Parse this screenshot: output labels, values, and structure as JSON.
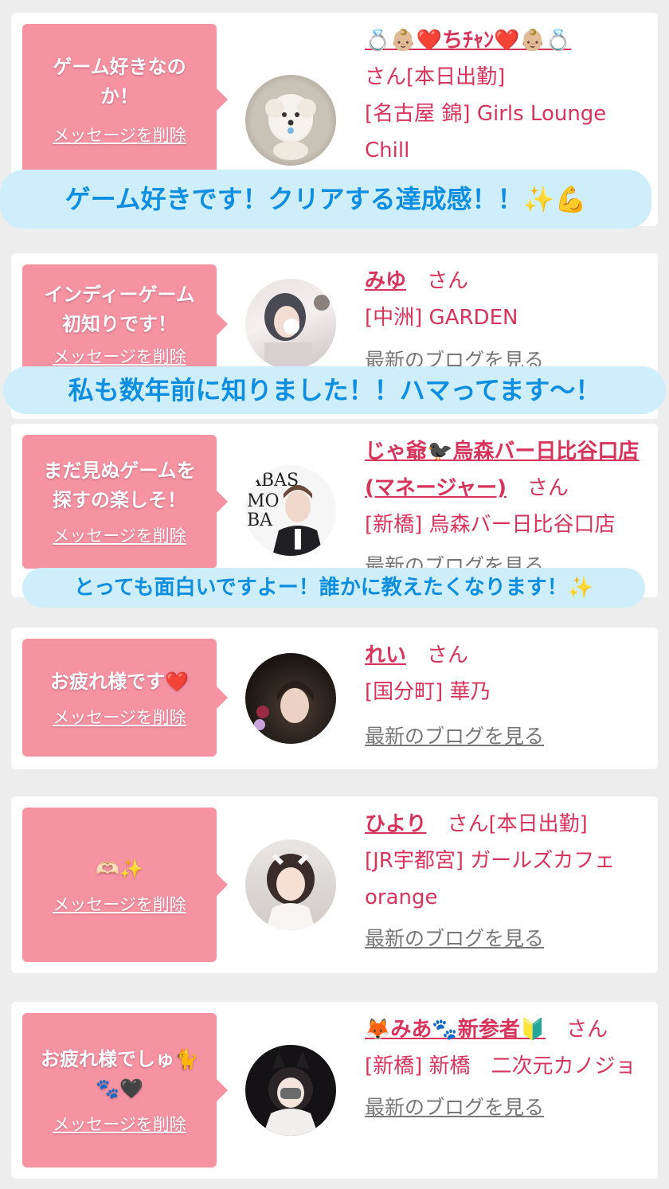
{
  "entries": [
    {
      "message": "ゲーム好きなの\nか！",
      "delete_label": "メッセージを削除",
      "avatar_icon": "white-puppy-photo",
      "name": "💍👶🏼❤️ちﾁｬﾝ❤️👶🏼💍",
      "honorific": "さん",
      "status": "[本日出勤]",
      "area": "[名古屋 錦] Girls Lounge Chill",
      "blog_link": ""
    },
    {
      "message": "インディーゲーム\n初知りです！",
      "delete_label": "メッセージを削除",
      "avatar_icon": "girl-photo",
      "name": "みゆ",
      "honorific": "さん",
      "status": "",
      "area": "[中洲] GARDEN",
      "blog_link": "最新のブログを見る"
    },
    {
      "message": "まだ見ぬゲームを\n探すの楽しそ！",
      "delete_label": "メッセージを削除",
      "avatar_icon": "man-in-suit-photo",
      "name": "じゃ爺🐦‍⬛烏森バー日比谷口店(マネージャー)",
      "honorific": "さん",
      "status": "",
      "area": "[新橋] 烏森バー日比谷口店",
      "blog_link": "最新のブログを見る"
    },
    {
      "message": "お疲れ様です❤️",
      "delete_label": "メッセージを削除",
      "avatar_icon": "woman-dark-photo",
      "name": "れい",
      "honorific": "さん",
      "status": "",
      "area": "[国分町] 華乃",
      "blog_link": "最新のブログを見る"
    },
    {
      "message": "🫶🏻✨",
      "delete_label": "メッセージを削除",
      "avatar_icon": "girl-maid-photo",
      "name": "ひより",
      "honorific": "さん",
      "status": "[本日出勤]",
      "area": "[JR宇都宮] ガールズカフェ orange",
      "blog_link": "最新のブログを見る"
    },
    {
      "message": "お疲れ様でしゅ🐈\n🐾🖤",
      "delete_label": "メッセージを削除",
      "avatar_icon": "girl-cat-ears-photo",
      "name": "🦊みあ🐾新参者🔰",
      "honorific": "さん",
      "status": "",
      "area": "[新橋] 新橋　二次元カノジョ",
      "blog_link": "最新のブログを見る"
    }
  ],
  "overlays": [
    "ゲーム好きです！クリアする達成感！！✨💪",
    "私も数年前に知りました！！ハマってます〜！",
    "とっても面白いですよー！誰かに教えたくなります！✨"
  ],
  "colors": {
    "bubble": "#f593a3",
    "name_text": "#d6345a",
    "overlay_bg": "#cfeefc",
    "overlay_text": "#0e8ee0"
  }
}
